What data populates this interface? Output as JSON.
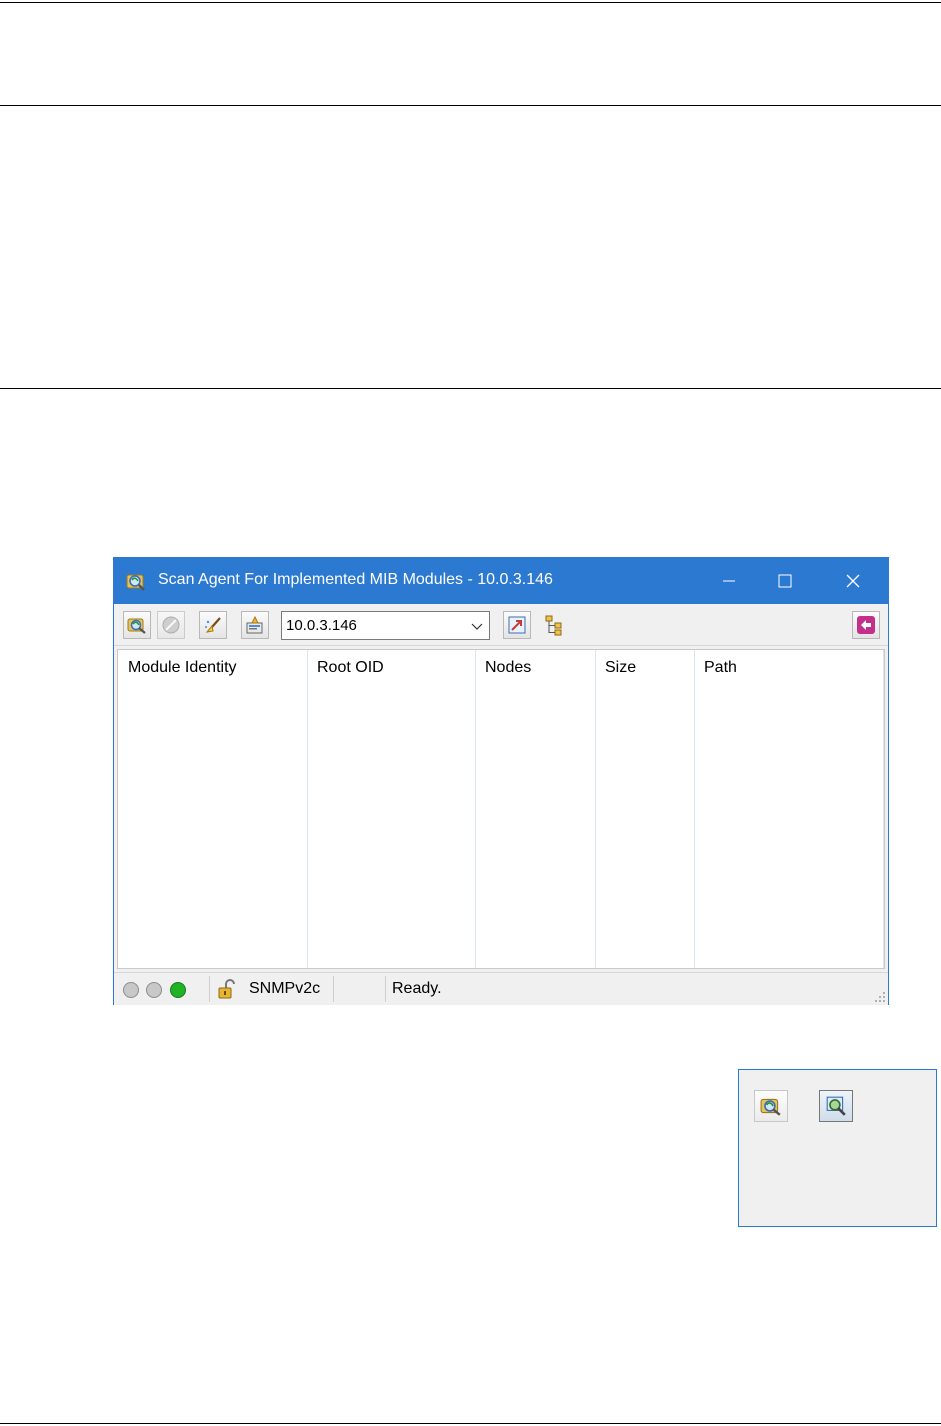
{
  "window": {
    "title": "Scan Agent For Implemented MIB Modules - 10.0.3.146",
    "controls": {
      "minimize": "—",
      "maximize": "☐",
      "close": "✕"
    }
  },
  "toolbar": {
    "agent_address": "10.0.3.146",
    "icons": [
      "scan-agent-icon",
      "stop-icon",
      "clear-list-icon",
      "properties-icon",
      "address-dropdown-icon",
      "load-module-icon",
      "mib-tree-icon",
      "exit-icon"
    ]
  },
  "table": {
    "columns": [
      "Module Identity",
      "Root OID",
      "Nodes",
      "Size",
      "Path"
    ],
    "rows": []
  },
  "statusbar": {
    "led_colors": [
      "#c8c8c8",
      "#c8c8c8",
      "#1fb325"
    ],
    "protocol": "SNMPv2c",
    "status": "Ready."
  },
  "side_panel": {
    "icons": [
      "scan-agent-icon",
      "search-mib-icon"
    ]
  },
  "colors": {
    "titlebar": "#2b79d0",
    "window_bg": "#f0f0f0",
    "exit_button": "#c2308b"
  }
}
